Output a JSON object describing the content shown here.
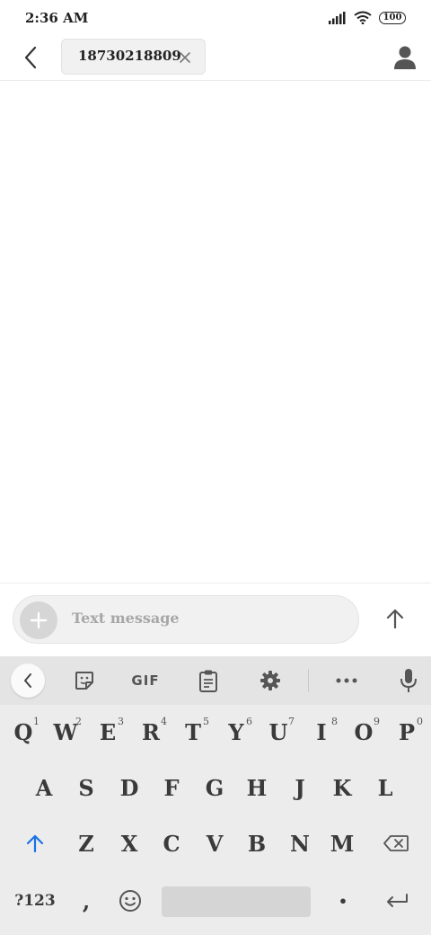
{
  "status_bar": {
    "time": "2:36 AM",
    "battery": "100",
    "icons": [
      "signal-icon",
      "wifi-icon",
      "battery-icon"
    ]
  },
  "header": {
    "back_icon": "back-arrow-icon",
    "recipient": "18730218809",
    "chip_close_icon": "close-icon",
    "contact_icon": "person-icon"
  },
  "compose": {
    "attach_icon": "plus-icon",
    "placeholder": "Text message",
    "send_icon": "arrow-up-icon"
  },
  "keyboard": {
    "toolbar": {
      "items": [
        "chevron-left-icon",
        "sticker-icon",
        "GIF",
        "clipboard-icon",
        "gear-icon",
        "more-icon",
        "mic-icon"
      ],
      "gif_label": "GIF"
    },
    "row1": [
      {
        "key": "Q",
        "hint": "1"
      },
      {
        "key": "W",
        "hint": "2"
      },
      {
        "key": "E",
        "hint": "3"
      },
      {
        "key": "R",
        "hint": "4"
      },
      {
        "key": "T",
        "hint": "5"
      },
      {
        "key": "Y",
        "hint": "6"
      },
      {
        "key": "U",
        "hint": "7"
      },
      {
        "key": "I",
        "hint": "8"
      },
      {
        "key": "O",
        "hint": "9"
      },
      {
        "key": "P",
        "hint": "0"
      }
    ],
    "row2": [
      "A",
      "S",
      "D",
      "F",
      "G",
      "H",
      "J",
      "K",
      "L"
    ],
    "row3": [
      "Z",
      "X",
      "C",
      "V",
      "B",
      "N",
      "M"
    ],
    "symbols_label": "?123",
    "comma_label": ",",
    "period_label": "•",
    "accent_color": "#1a73e8"
  }
}
